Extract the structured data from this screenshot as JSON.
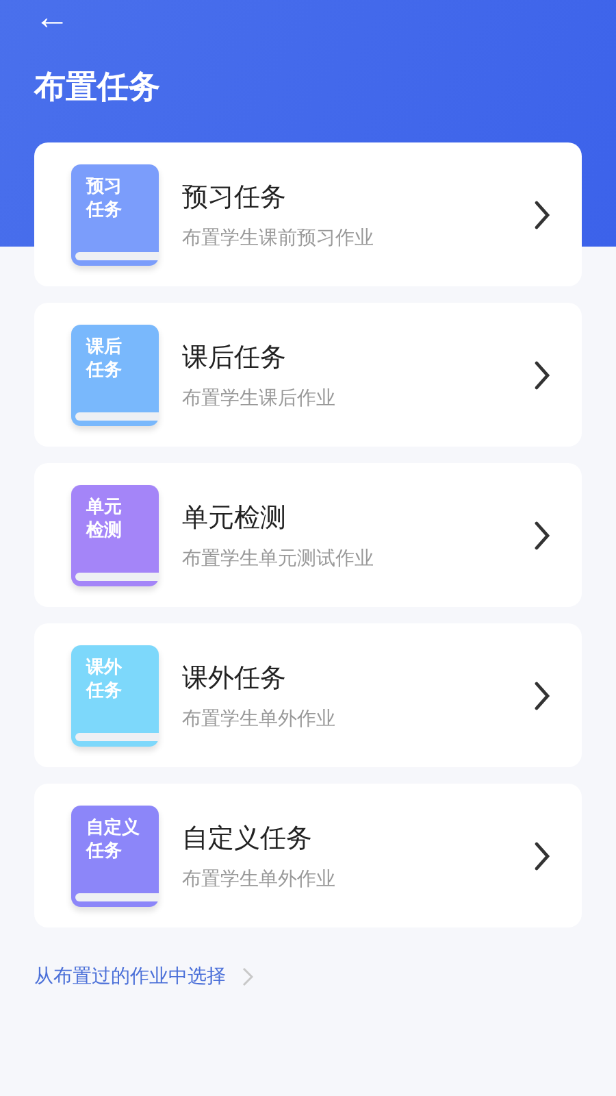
{
  "header": {
    "back": "←",
    "title": "布置任务"
  },
  "tasks": [
    {
      "badge": "预习任务",
      "title": "预习任务",
      "subtitle": "布置学生课前预习作业",
      "color": "#7b9dfb"
    },
    {
      "badge": "课后任务",
      "title": "课后任务",
      "subtitle": "布置学生课后作业",
      "color": "#79b8fc"
    },
    {
      "badge": "单元检测",
      "title": "单元检测",
      "subtitle": "布置学生单元测试作业",
      "color": "#a485f8"
    },
    {
      "badge": "课外任务",
      "title": "课外任务",
      "subtitle": "布置学生单外作业",
      "color": "#7dd8fb"
    },
    {
      "badge": "自定义任务",
      "title": "自定义任务",
      "subtitle": "布置学生单外作业",
      "color": "#8c86f9"
    }
  ],
  "history_link": "从布置过的作业中选择"
}
